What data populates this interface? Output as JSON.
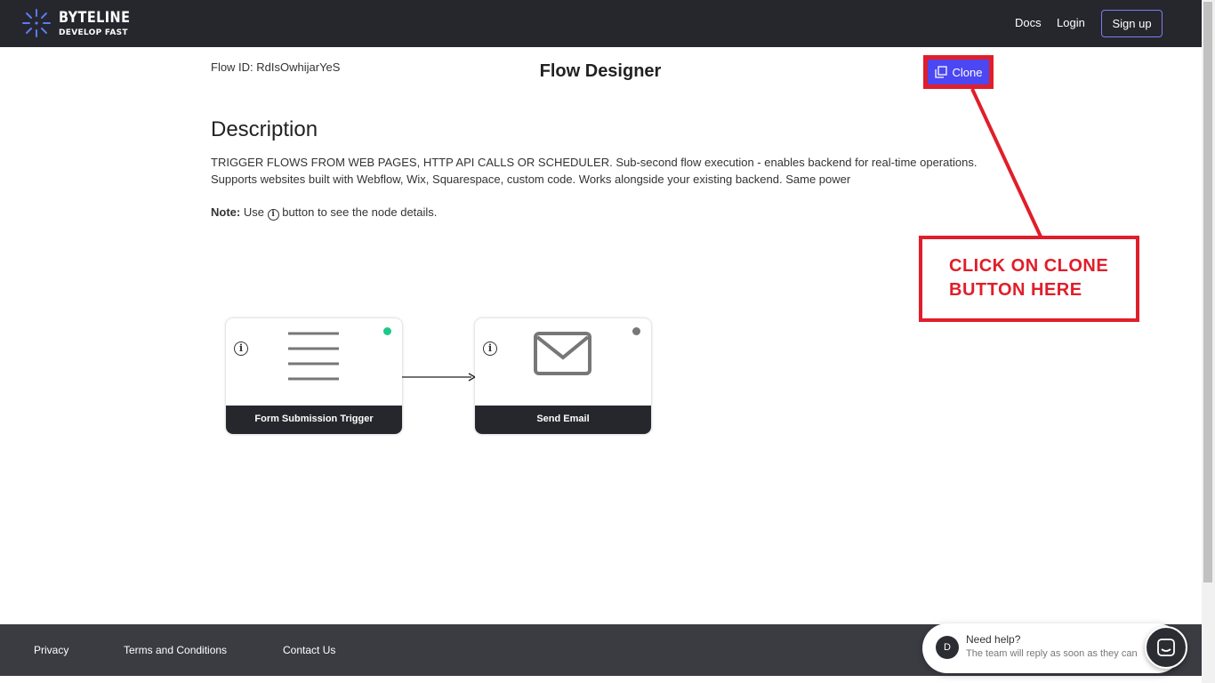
{
  "header": {
    "brand_name": "BYTELINE",
    "brand_tagline": "DEVELOP FAST",
    "nav": {
      "docs": "Docs",
      "login": "Login",
      "signup": "Sign up"
    }
  },
  "page": {
    "flow_id": "Flow ID: RdIsOwhijarYeS",
    "title": "Flow Designer",
    "clone_label": "Clone",
    "description_heading": "Description",
    "description_text": "TRIGGER FLOWS FROM WEB PAGES, HTTP API CALLS OR SCHEDULER. Sub-second flow execution - enables backend for real-time operations. Supports websites built with Webflow, Wix, Squarespace, custom code. Works alongside your existing backend. Same power",
    "note_label": "Note:",
    "note_before": "Use",
    "note_after": "button to see the node details."
  },
  "annotation": {
    "line1": "CLICK ON CLONE",
    "line2": "BUTTON HERE"
  },
  "nodes": [
    {
      "label": "Form Submission Trigger",
      "icon": "list-lines-icon",
      "status_color": "#1dc98a"
    },
    {
      "label": "Send Email",
      "icon": "envelope-icon",
      "status_color": "#777777"
    }
  ],
  "footer": {
    "privacy": "Privacy",
    "terms": "Terms and Conditions",
    "contact": "Contact Us"
  },
  "chat": {
    "avatar_initial": "D",
    "title": "Need help?",
    "subtitle": "The team will reply as soon as they can"
  },
  "colors": {
    "accent": "#4b47f2",
    "annotation_red": "#e01e2a",
    "dark": "#25272d"
  }
}
